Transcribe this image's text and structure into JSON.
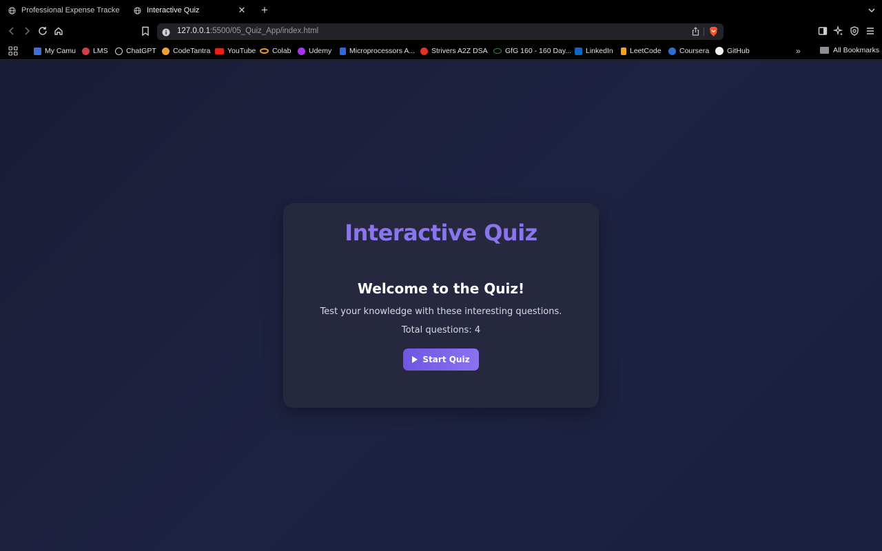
{
  "tabs": [
    {
      "title": "Professional Expense Tracker",
      "active": false
    },
    {
      "title": "Interactive Quiz",
      "active": true
    }
  ],
  "toolbar": {
    "url_host": "127.0.0.1",
    "url_rest": ":5500/05_Quiz_App/index.html"
  },
  "bookmarks": [
    {
      "label": "My Camu",
      "icon": "camu-icon",
      "color": "#3b6fd6"
    },
    {
      "label": "LMS",
      "icon": "lms-icon",
      "color": "#d63b4a"
    },
    {
      "label": "ChatGPT",
      "icon": "chatgpt-icon",
      "color": "#d9d9d9"
    },
    {
      "label": "CodeTantra",
      "icon": "codetantra-icon",
      "color": "#f0a030"
    },
    {
      "label": "YouTube",
      "icon": "youtube-icon",
      "color": "#e62117"
    },
    {
      "label": "Colab",
      "icon": "colab-icon",
      "color": "#f59b1c"
    },
    {
      "label": "Udemy",
      "icon": "udemy-icon",
      "color": "#a435f0"
    },
    {
      "label": "Microprocessors A...",
      "icon": "scribd-icon",
      "color": "#2a6ae0"
    },
    {
      "label": "Strivers A2Z DSA",
      "icon": "takeuforward-icon",
      "color": "#e0312b"
    },
    {
      "label": "GfG 160 - 160 Day...",
      "icon": "gfg-icon",
      "color": "#2f8d46"
    },
    {
      "label": "LinkedIn",
      "icon": "linkedin-icon",
      "color": "#0a66c2"
    },
    {
      "label": "LeetCode",
      "icon": "leetcode-icon",
      "color": "#f89f1b"
    },
    {
      "label": "Coursera",
      "icon": "coursera-icon",
      "color": "#2a73cc"
    },
    {
      "label": "GitHub",
      "icon": "github-icon",
      "color": "#f0f0f0"
    }
  ],
  "all_bookmarks_label": "All Bookmarks",
  "quiz": {
    "app_title": "Interactive Quiz",
    "welcome_heading": "Welcome to the Quiz!",
    "description": "Test your knowledge with these interesting questions.",
    "total_questions_text": "Total questions: 4",
    "start_button_label": "Start Quiz"
  },
  "colors": {
    "accent": "#8b75ee",
    "button_start": "#6f56e4",
    "card_bg": "#25283f",
    "page_bg": "#1d2140"
  }
}
